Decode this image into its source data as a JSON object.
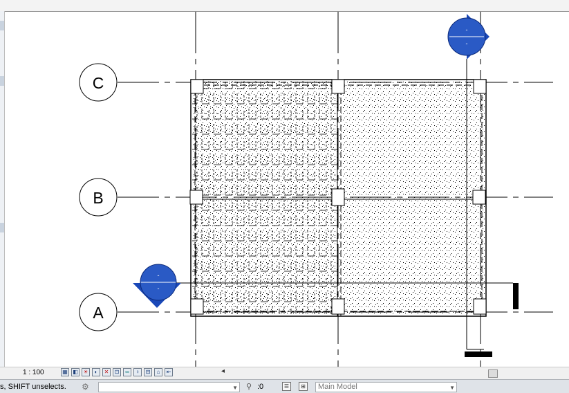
{
  "canvas": {
    "grid_labels": [
      "C",
      "B",
      "A"
    ],
    "section_tag_text": "-"
  },
  "view_control_bar": {
    "scale": "1 : 100",
    "icons": [
      "detail-level-icon",
      "visual-style-icon",
      "sun-path-icon",
      "shadows-icon",
      "crop-view-icon",
      "show-crop-region-icon",
      "temporary-hide-icon",
      "reveal-hidden-icon",
      "analytical-model-icon",
      "highlight-displacement-icon",
      "reveal-constraints-icon"
    ],
    "scroll_left_glyph": "◂"
  },
  "status_bar": {
    "message": "s, SHIFT unselects.",
    "filter_count": ":0",
    "model": "Main Model"
  }
}
